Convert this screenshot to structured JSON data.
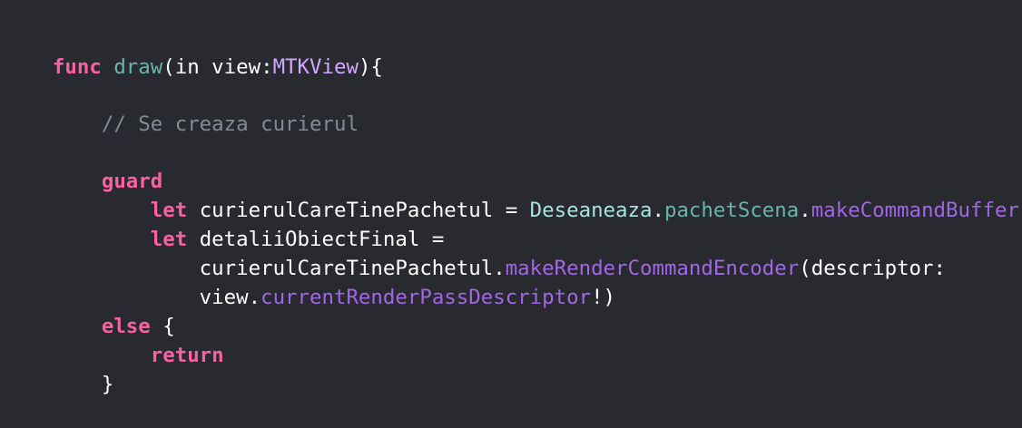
{
  "colors": {
    "background": "#292a30",
    "plain": "#ffffff",
    "keyword": "#fc5fa3",
    "function_name": "#67b7a4",
    "type": "#d0a8ff",
    "comment": "#7f8c98",
    "class_name": "#a8e5d8",
    "property": "#67b7a4",
    "method": "#a167e6"
  },
  "code": {
    "lines": [
      {
        "tokens": [
          {
            "text": "func",
            "kind": "keyword"
          },
          {
            "text": " ",
            "kind": "plain"
          },
          {
            "text": "draw",
            "kind": "func"
          },
          {
            "text": "(in view:",
            "kind": "plain"
          },
          {
            "text": "MTKView",
            "kind": "type"
          },
          {
            "text": "){",
            "kind": "plain"
          }
        ]
      },
      {
        "tokens": [
          {
            "text": "    ",
            "kind": "plain"
          },
          {
            "text": "// Se creaza curierul",
            "kind": "comment"
          }
        ]
      },
      {
        "tokens": [
          {
            "text": "    ",
            "kind": "plain"
          },
          {
            "text": "guard",
            "kind": "keyword"
          }
        ]
      },
      {
        "tokens": [
          {
            "text": "        ",
            "kind": "plain"
          },
          {
            "text": "let",
            "kind": "keyword"
          },
          {
            "text": " curierulCareTinePachetul = ",
            "kind": "plain"
          },
          {
            "text": "Deseaneaza",
            "kind": "class"
          },
          {
            "text": ".",
            "kind": "plain"
          },
          {
            "text": "pachetScena",
            "kind": "prop"
          },
          {
            "text": ".",
            "kind": "plain"
          },
          {
            "text": "makeCommandBuffer",
            "kind": "method"
          },
          {
            "text": "(),",
            "kind": "plain"
          }
        ]
      },
      {
        "tokens": [
          {
            "text": "        ",
            "kind": "plain"
          },
          {
            "text": "let",
            "kind": "keyword"
          },
          {
            "text": " detaliiObiectFinal =",
            "kind": "plain"
          }
        ]
      },
      {
        "tokens": [
          {
            "text": "            curierulCareTinePachetul.",
            "kind": "plain"
          },
          {
            "text": "makeRenderCommandEncoder",
            "kind": "method"
          },
          {
            "text": "(descriptor:",
            "kind": "plain"
          }
        ]
      },
      {
        "tokens": [
          {
            "text": "            view.",
            "kind": "plain"
          },
          {
            "text": "currentRenderPassDescriptor",
            "kind": "method"
          },
          {
            "text": "!)",
            "kind": "plain"
          }
        ]
      },
      {
        "tokens": [
          {
            "text": "    ",
            "kind": "plain"
          },
          {
            "text": "else",
            "kind": "keyword"
          },
          {
            "text": " {",
            "kind": "plain"
          }
        ]
      },
      {
        "tokens": [
          {
            "text": "        ",
            "kind": "plain"
          },
          {
            "text": "return",
            "kind": "keyword"
          }
        ]
      },
      {
        "tokens": [
          {
            "text": "    }",
            "kind": "plain"
          }
        ]
      }
    ]
  }
}
